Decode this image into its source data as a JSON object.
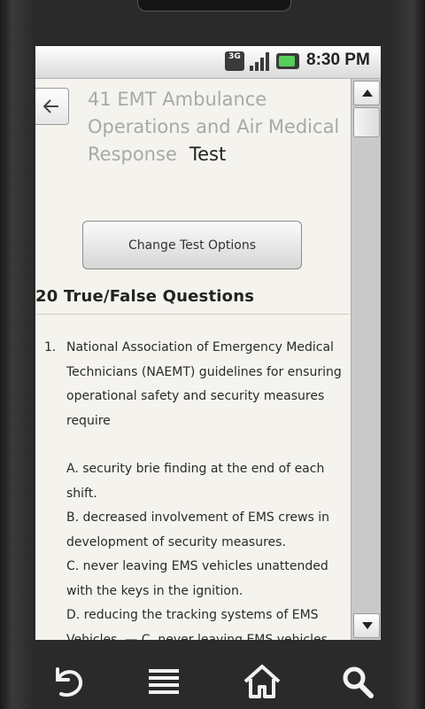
{
  "status_bar": {
    "network_label": "3G",
    "time": "8:30 PM"
  },
  "header": {
    "title": "41 EMT Ambulance Operations and Air Medical Response",
    "title_suffix": "Test"
  },
  "change_button": {
    "label": "Change Test Options"
  },
  "section": {
    "heading": "20 True/False Questions"
  },
  "question": {
    "number": "1.",
    "text": "National Association of Emergency Medical Technicians (NAEMT) guidelines for ensuring operational safety and security measures require",
    "option_a": "A. security brie finding at the end of each shift.",
    "option_b": "B. decreased involvement of EMS crews in development of security measures.",
    "option_c": "C. never leaving EMS vehicles unattended with the keys in the ignition.",
    "option_d": "D. reducing the tracking systems of EMS Vehicles. — C. never leaving EMS vehicles unattended with the keys in the ignition."
  },
  "nav": {
    "icons": [
      "back-icon",
      "menu-icon",
      "home-icon",
      "search-icon"
    ]
  },
  "colors": {
    "title_gray": "#a8a8a8",
    "screen_bg": "#f5f3ee",
    "battery_green": "#56d05a"
  }
}
